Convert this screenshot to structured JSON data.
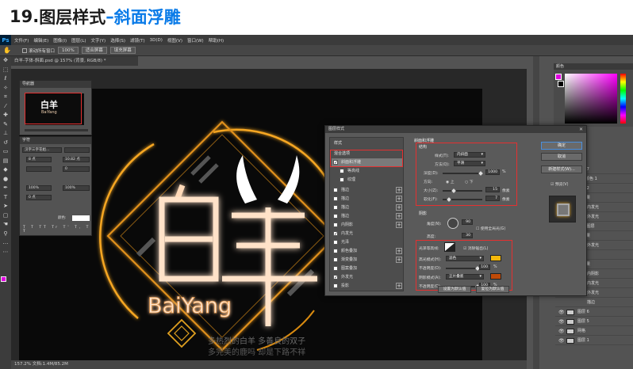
{
  "heading": {
    "number": "19.",
    "text": "图层样式",
    "dash": "–",
    "highlight": "斜面浮雕"
  },
  "app": {
    "logo": "Ps",
    "menu": [
      "文件(F)",
      "编辑(E)",
      "图像(I)",
      "图层(L)",
      "文字(Y)",
      "选择(S)",
      "滤镜(T)",
      "3D(D)",
      "视图(V)",
      "窗口(W)",
      "帮助(H)"
    ],
    "options": {
      "scroll_all": "滚动所有窗口",
      "zoom": "100%",
      "fit": "适合屏幕",
      "fill": "填充屏幕"
    },
    "doc_tab": "白羊-字体-斜面.psd @ 157% (背景, RGB/8) *",
    "status": "157.2%    文档:1.4M/85.2M"
  },
  "navigator": {
    "title": "导航器",
    "thumb_main": "白羊",
    "thumb_sub": "BaiYang"
  },
  "character": {
    "title": "字符",
    "font": "汉字三字花姐...",
    "size": "8 点",
    "leading": "10.82 点",
    "tracking": "0",
    "scale_v": "100%",
    "scale_h": "100%",
    "baseline": "0 点",
    "color_label": "颜色:"
  },
  "artwork": {
    "main": "白羊",
    "sub": "BaiYang",
    "caption1": "多热烈的白羊  多善良的双子",
    "caption2": "多完美的鹿吗  却是下路不祥"
  },
  "dialog": {
    "title": "图层样式",
    "list_header": "样式",
    "items": [
      {
        "label": "混合选项",
        "head": true
      },
      {
        "label": "斜面和浮雕",
        "checked": true,
        "selected": true
      },
      {
        "label": "等高线",
        "checked": false,
        "indent": true
      },
      {
        "label": "纹理",
        "checked": false,
        "indent": true
      },
      {
        "label": "描边",
        "checked": false,
        "plus": true
      },
      {
        "label": "描边",
        "checked": false,
        "plus": true
      },
      {
        "label": "描边",
        "checked": false,
        "plus": true
      },
      {
        "label": "描边",
        "checked": false,
        "plus": true
      },
      {
        "label": "内阴影",
        "checked": false,
        "plus": true
      },
      {
        "label": "内发光",
        "checked": true
      },
      {
        "label": "光泽",
        "checked": false
      },
      {
        "label": "颜色叠加",
        "checked": false,
        "plus": true
      },
      {
        "label": "渐变叠加",
        "checked": false,
        "plus": true
      },
      {
        "label": "图案叠加",
        "checked": false
      },
      {
        "label": "外发光",
        "checked": true
      },
      {
        "label": "投影",
        "checked": false,
        "plus": true
      }
    ],
    "bevel_title": "斜面和浮雕",
    "structure": "结构",
    "style_label": "样式(T):",
    "style_value": "内斜面",
    "technique_label": "方法(Q):",
    "technique_value": "平滑",
    "depth_label": "深度(D):",
    "depth_value": "1000",
    "percent": "%",
    "direction_label": "方向:",
    "dir_up": "上",
    "dir_down": "下",
    "size_label": "大小(Z):",
    "size_value": "15",
    "px": "像素",
    "soften_label": "软化(F):",
    "soften_value": "7",
    "shading": "阴影",
    "angle_label": "角度(N):",
    "angle_value": "90",
    "global_light": "使用全局光(G)",
    "altitude_label": "高度:",
    "altitude_value": "30",
    "gloss_label": "光泽等高线:",
    "antialias": "消除锯齿(L)",
    "highlight_mode_label": "高光模式(H):",
    "highlight_mode": "滤色",
    "highlight_opacity_label": "不透明度(O):",
    "highlight_opacity": "100",
    "shadow_mode_label": "阴影模式(A):",
    "shadow_mode": "正片叠底",
    "shadow_opacity_label": "不透明度(C):",
    "shadow_opacity": "100",
    "make_default": "设置为默认值",
    "reset_default": "复位为默认值",
    "ok": "确定",
    "cancel": "取消",
    "new_style": "新建样式(W)...",
    "preview": "预览(V)",
    "highlight_color": "#f5b80a",
    "shadow_color": "#c04a08"
  },
  "color_panel": {
    "title": "颜色"
  },
  "layers": [
    {
      "name": "图层 7"
    },
    {
      "name": "选取颜色 1"
    },
    {
      "name": "图层 2"
    },
    {
      "name": "效果"
    },
    {
      "name": "内发光"
    },
    {
      "name": "外发光"
    },
    {
      "name": "文字 图层"
    },
    {
      "name": "效果"
    },
    {
      "name": "外发光"
    },
    {
      "name": "背景"
    },
    {
      "name": "效果"
    },
    {
      "name": "内阴影"
    },
    {
      "name": "内发光"
    },
    {
      "name": "外发光"
    },
    {
      "name": "描边"
    },
    {
      "name": "图层 6"
    },
    {
      "name": "图层 5"
    },
    {
      "name": "网格"
    },
    {
      "name": "图层 1"
    }
  ]
}
